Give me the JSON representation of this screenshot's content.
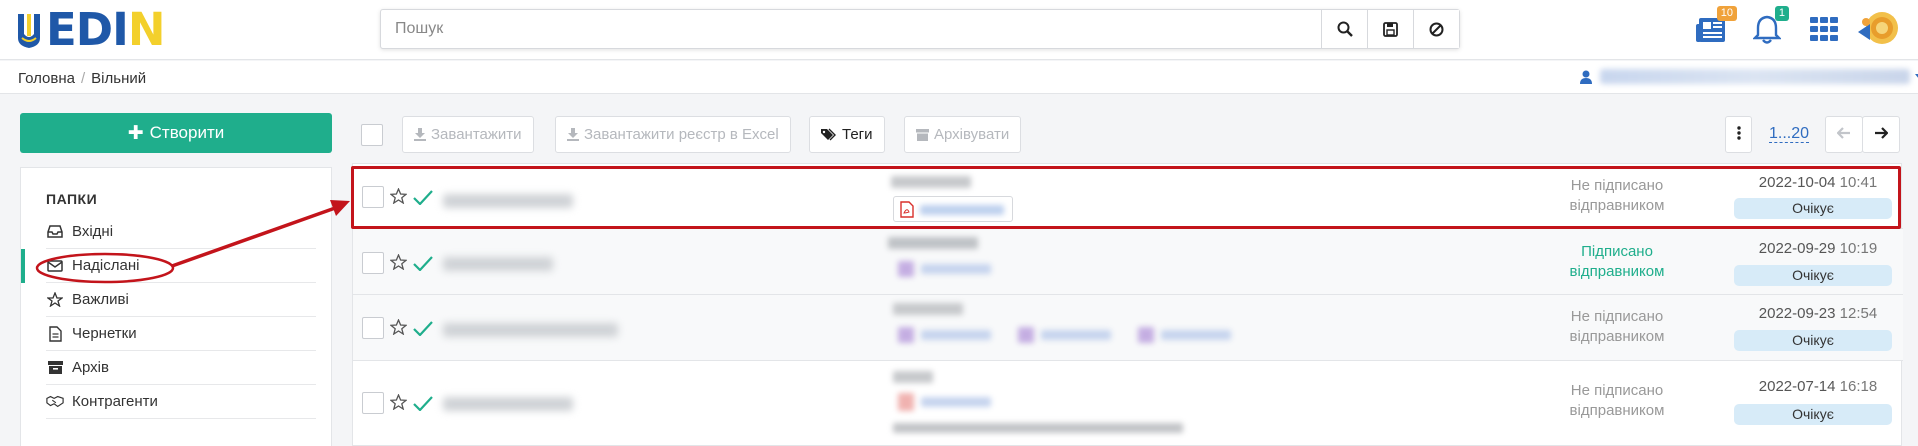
{
  "header": {
    "logo_text": "EDIN",
    "search": {
      "placeholder": "Пошук",
      "value": ""
    },
    "badges": {
      "news": "10",
      "notifications": "1"
    }
  },
  "breadcrumb": {
    "home": "Головна",
    "current": "Вільний"
  },
  "sidebar": {
    "create_label": "Створити",
    "folders_title": "ПАПКИ",
    "items": [
      {
        "label": "Вхідні",
        "icon": "inbox-icon"
      },
      {
        "label": "Надіслані",
        "icon": "envelope-icon",
        "active": true
      },
      {
        "label": "Важливі",
        "icon": "star-icon"
      },
      {
        "label": "Чернетки",
        "icon": "file-text-icon"
      },
      {
        "label": "Архів",
        "icon": "archive-icon"
      },
      {
        "label": "Контрагенти",
        "icon": "handshake-icon"
      }
    ]
  },
  "toolbar": {
    "download_label": "Завантажити",
    "export_label": "Завантажити реєстр в Excel",
    "tags_label": "Теги",
    "archive_label": "Архівувати",
    "range": "1...20"
  },
  "messages": [
    {
      "status": "Не підписано відправником",
      "status_type": "unsigned",
      "date": "2022-10-04",
      "time": "10:41",
      "state": "Очікує"
    },
    {
      "status": "Підписано відправником",
      "status_type": "signed",
      "date": "2022-09-29",
      "time": "10:19",
      "state": "Очікує"
    },
    {
      "status": "Не підписано відправником",
      "status_type": "unsigned",
      "date": "2022-09-23",
      "time": "12:54",
      "state": "Очікує"
    },
    {
      "status": "Не підписано відправником",
      "status_type": "unsigned",
      "date": "2022-07-14",
      "time": "16:18",
      "state": "Очікує"
    }
  ],
  "colors": {
    "accent": "#1fae8c",
    "highlight": "#c3141b",
    "logo_blue": "#1f58a8",
    "logo_yellow": "#f3d02c",
    "pill_bg": "#d7ebf8"
  }
}
